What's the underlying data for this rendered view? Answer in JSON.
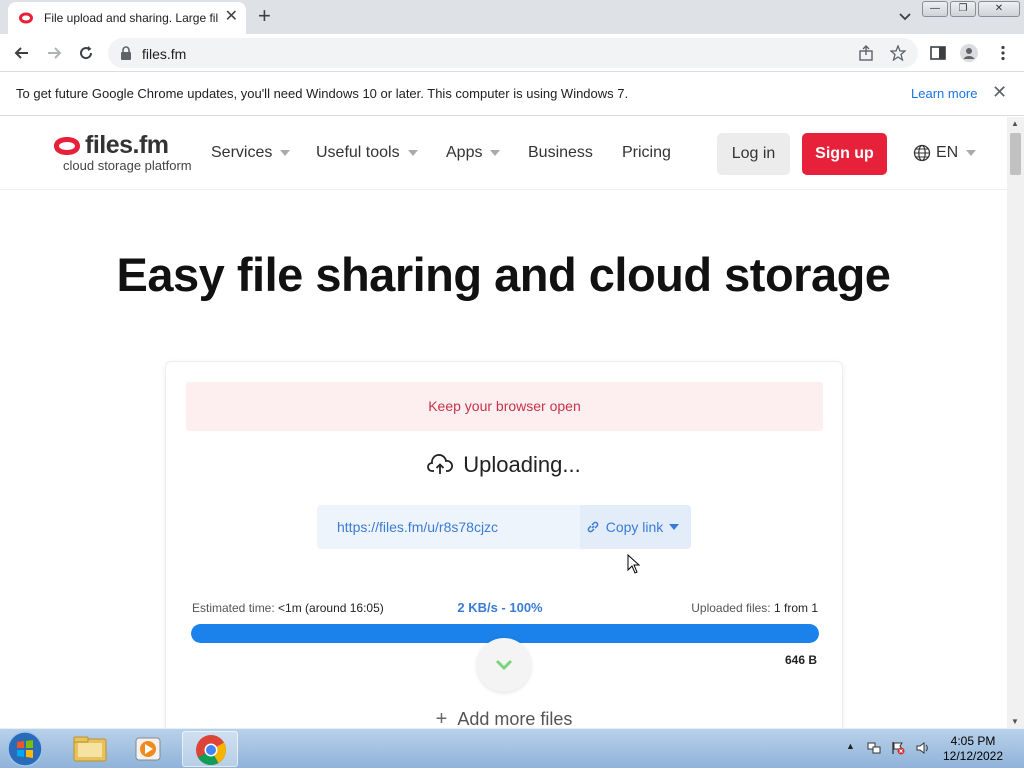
{
  "browser": {
    "tab_title": "File upload and sharing. Large fil",
    "url": "files.fm",
    "info_message": "To get future Google Chrome updates, you'll need Windows 10 or later. This computer is using Windows 7.",
    "learn_more": "Learn more"
  },
  "site": {
    "logo_text": "files.fm",
    "logo_tagline": "cloud storage platform",
    "nav": [
      "Services",
      "Useful tools",
      "Apps",
      "Business",
      "Pricing"
    ],
    "login": "Log in",
    "signup": "Sign up",
    "language": "EN",
    "brand_color": "#e8213a"
  },
  "hero": {
    "title": "Easy file sharing and cloud storage"
  },
  "upload": {
    "notice": "Keep your browser open",
    "status": "Uploading...",
    "link": "https://files.fm/u/r8s78cjzc",
    "copy_label": "Copy link",
    "est_label": "Estimated time:",
    "est_value": "<1m (around 16:05)",
    "speed": "2 KB/s - 100%",
    "uploaded_label": "Uploaded files:",
    "uploaded_value": "1 from 1",
    "progress": 1.0,
    "size": "646 B",
    "add_more": "Add more files",
    "accent_color": "#1a82ea"
  },
  "taskbar": {
    "time": "4:05 PM",
    "date": "12/12/2022"
  }
}
